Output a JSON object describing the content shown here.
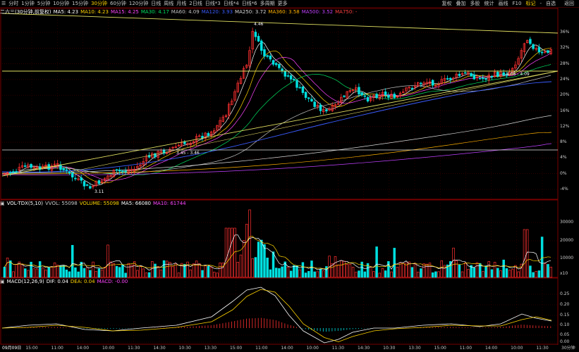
{
  "toolbar": {
    "menu_icon": "hamburger-icon",
    "periods": [
      "分时",
      "1分钟",
      "5分钟",
      "10分钟",
      "15分钟",
      "30分钟",
      "60分钟",
      "120分钟",
      "日线",
      "周线",
      "月线",
      "2日线",
      "日线*3",
      "日线*4",
      "日线*6",
      "多周期",
      "更多"
    ],
    "active_period": "30分钟",
    "right_buttons": [
      "复权",
      "叠加",
      "多股",
      "统计",
      "画线",
      "F10",
      "标记",
      "-",
      "自选",
      "返回"
    ],
    "active_right": "标记",
    "close_label": "返回"
  },
  "price_header": {
    "stock_label": "二六三(30分钟,前复权)",
    "indicators": [
      {
        "label": "MA5: 4.23",
        "color": "#ffffff"
      },
      {
        "label": "MA10: 4.23",
        "color": "#ffd400"
      },
      {
        "label": "MA15: 4.25",
        "color": "#ff44ff"
      },
      {
        "label": "MA30: 4.17",
        "color": "#00e060"
      },
      {
        "label": "MA60: 4.09",
        "color": "#c0c0c0"
      },
      {
        "label": "MA120: 3.93",
        "color": "#3a5cff"
      },
      {
        "label": "MA250: 3.72",
        "color": "#d8d8d8"
      },
      {
        "label": "MA360: 3.58",
        "color": "#ffb000"
      },
      {
        "label": "MA500: 3.52",
        "color": "#c040ff"
      },
      {
        "label": "MA750: -",
        "color": "#ff4040"
      }
    ]
  },
  "volume_header": {
    "label": "VOL-TDX(5,10)",
    "indicators": [
      {
        "label": "VVOL: 55098",
        "color": "#c8c8c8"
      },
      {
        "label": "VOLUME: 55098",
        "color": "#ffd400"
      },
      {
        "label": "MA5: 66080",
        "color": "#ffffff"
      },
      {
        "label": "MA10: 61744",
        "color": "#ff44ff"
      }
    ]
  },
  "macd_header": {
    "label": "MACD(12,26,9)",
    "indicators": [
      {
        "label": "DIF: 0.04",
        "color": "#ffffff"
      },
      {
        "label": "DEA: 0.04",
        "color": "#ffd400"
      },
      {
        "label": "MACD: -0.00",
        "color": "#ff44ff"
      }
    ]
  },
  "price_axis": [
    "36%",
    "32%",
    "28%",
    "24%",
    "20%",
    "16%",
    "12%",
    "8%",
    "4%",
    "0%",
    "-4%"
  ],
  "volume_axis": [
    "30000",
    "20000",
    "10000",
    "x10"
  ],
  "macd_axis": [
    "0.25",
    "0.20",
    "0.15",
    "0.10",
    "0.05",
    "0.00"
  ],
  "time_axis": [
    "15:00",
    "11:00",
    "14:00",
    "10:00",
    "11:30",
    "14:30",
    "10:30",
    "13:30",
    "15:00",
    "11:00",
    "14:00",
    "10:00",
    "11:30",
    "14:30",
    "10:30",
    "13:30",
    "15:00",
    "11:00",
    "14:00",
    "10:00",
    "11:30"
  ],
  "date_label": "09月09日",
  "period_badge": "30分钟",
  "annotations": {
    "high": "4.46",
    "low": "3.11",
    "mid": "3.45 - 3.46",
    "right": "4.08 - 4.09"
  },
  "colors": {
    "up": "#ff3030",
    "down": "#00e0e0",
    "grid": "#4a0000",
    "background": "#000000",
    "trendline": "#e0e060"
  }
}
